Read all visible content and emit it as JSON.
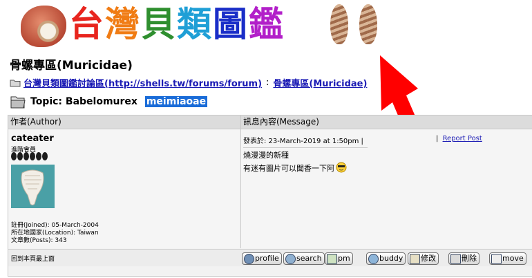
{
  "banner": {
    "title_chars": [
      "台",
      "灣",
      "貝",
      "類",
      "圖",
      "鑑"
    ],
    "title_colors": [
      "#e8251e",
      "#f07c14",
      "#2f8f2f",
      "#1f9fd6",
      "#1a2ec8",
      "#b21fc9"
    ]
  },
  "zone_title": "骨螺專區(Muricidae)",
  "breadcrumb": {
    "forum_link": "台灣貝類圖鑑討論區(http://shells.tw/forums/forum)",
    "separator": ":",
    "zone_link": "骨螺專區(Muricidae)"
  },
  "topic": {
    "prefix": "Topic: Babelomurex ",
    "highlight": "meimiaoae"
  },
  "table": {
    "author_header": "作者(Author)",
    "message_header": "訊息內容(Message)"
  },
  "post": {
    "author": "cateater",
    "rank": "進階會員",
    "joined": "註冊(Joined): 05-March-2004",
    "location": "所在地國家(Location): Taiwan",
    "posts": "文章數(Posts): 343",
    "posted": "發表於: 23-March-2019 at 1:50pm |",
    "report_sep": "|",
    "report_label": "Report Post",
    "message_lines": [
      "燒漫漫的新種",
      "有迷有圖片可以聞香一下阿"
    ],
    "back_to_top": "回到本頁最上面"
  },
  "actions": [
    "profile",
    "search",
    "pm",
    "buddy",
    "修改",
    "刪除",
    "move"
  ],
  "colors": {
    "link": "#1a1ab4",
    "highlight_bg": "#1a6cd8",
    "arrow": "#ff0000"
  }
}
